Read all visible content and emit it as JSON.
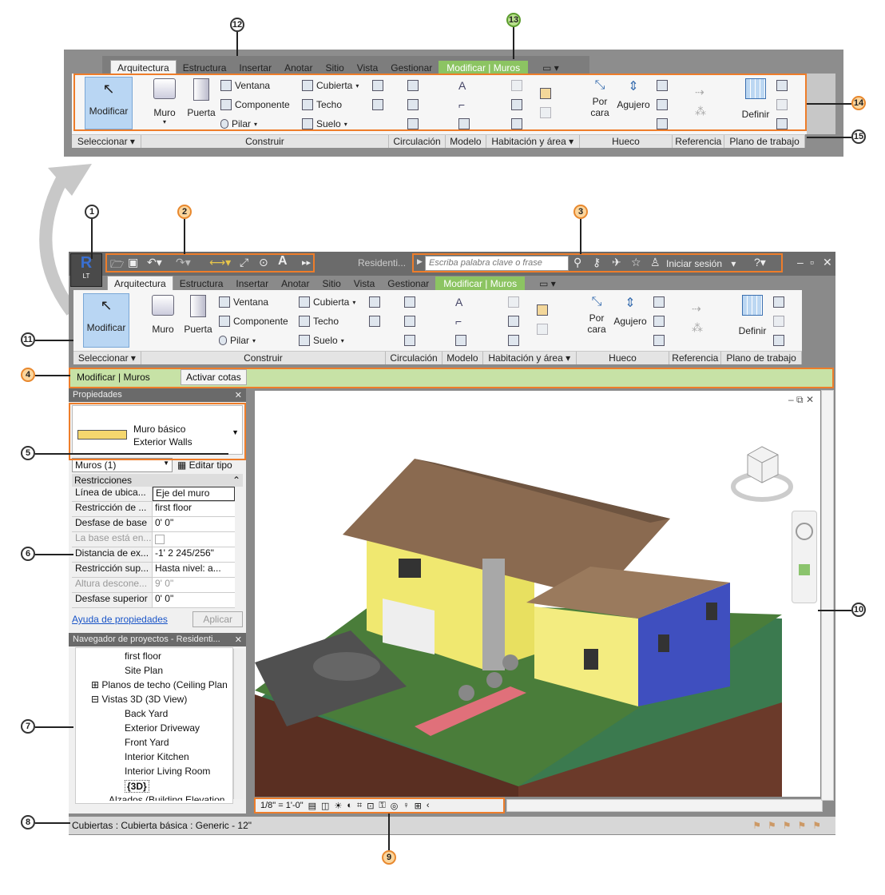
{
  "callouts": [
    "1",
    "2",
    "3",
    "4",
    "5",
    "6",
    "7",
    "8",
    "9",
    "10",
    "11",
    "12",
    "13",
    "14",
    "15"
  ],
  "ribbon": {
    "tabs": [
      "Arquitectura",
      "Estructura",
      "Insertar",
      "Anotar",
      "Sitio",
      "Vista",
      "Gestionar"
    ],
    "context_tab": "Modificar | Muros",
    "buttons": {
      "modificar": "Modificar",
      "muro": "Muro",
      "puerta": "Puerta",
      "ventana": "Ventana",
      "componente": "Componente",
      "pilar": "Pilar",
      "cubierta": "Cubierta",
      "techo": "Techo",
      "suelo": "Suelo",
      "por_cara": "Por\ncara",
      "agujero": "Agujero",
      "definir": "Definir"
    },
    "panels": [
      "Seleccionar",
      "Construir",
      "Circulación",
      "Modelo",
      "Habitación y área",
      "Hueco",
      "Referencia",
      "Plano de trabajo"
    ]
  },
  "titlebar": {
    "doc_title": "Residenti...",
    "search_placeholder": "Escriba palabra clave o frase",
    "signin": "Iniciar sesión",
    "app_letter": "LT"
  },
  "options_bar": {
    "context": "Modificar | Muros",
    "option": "Activar cotas"
  },
  "properties": {
    "title": "Propiedades",
    "type_line1": "Muro básico",
    "type_line2": "Exterior Walls",
    "filter": "Muros (1)",
    "edit_type": "Editar tipo",
    "section": "Restricciones",
    "rows": [
      {
        "k": "Línea de ubica...",
        "v": "Eje del muro"
      },
      {
        "k": "Restricción de ...",
        "v": "first floor"
      },
      {
        "k": "Desfase de base",
        "v": "0'  0\""
      },
      {
        "k": "La base está en...",
        "v": ""
      },
      {
        "k": "Distancia de ex...",
        "v": "-1'  2 245/256\""
      },
      {
        "k": "Restricción sup...",
        "v": "Hasta nivel: a..."
      },
      {
        "k": "Altura descone...",
        "v": "9'  0\""
      },
      {
        "k": "Desfase superior",
        "v": "0'  0\""
      }
    ],
    "help": "Ayuda de propiedades",
    "apply": "Aplicar"
  },
  "browser": {
    "title": "Navegador de proyectos - Residenti...",
    "items": [
      "first floor",
      "Site Plan",
      "Planos de techo (Ceiling Plan",
      "Vistas 3D (3D View)",
      "Back Yard",
      "Exterior Driveway",
      "Front Yard",
      "Interior Kitchen",
      "Interior Living Room",
      "{3D}",
      "Alzados (Building Elevation"
    ]
  },
  "view_control": {
    "scale": "1/8\" = 1'-0\""
  },
  "status": {
    "text": "Cubiertas : Cubierta básica : Generic - 12\""
  }
}
